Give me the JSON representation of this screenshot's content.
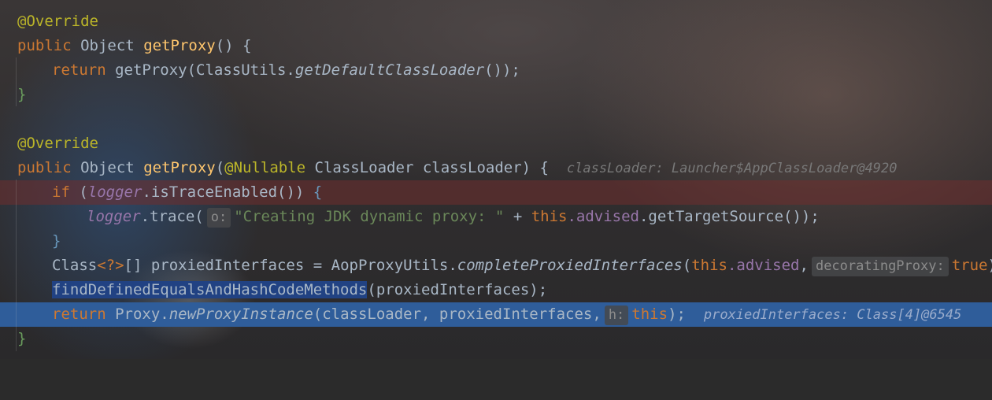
{
  "editor": {
    "lines": [
      {
        "id": "l1",
        "text": "@Override"
      },
      {
        "id": "l2",
        "kw": "public",
        "type": "Object",
        "name": "getProxy",
        "rest": "() {"
      },
      {
        "id": "l3",
        "kw": "return",
        "call": "getProxy(ClassUtils.",
        "method": "getDefaultClassLoader",
        "tail": "());"
      },
      {
        "id": "l4",
        "text": "}"
      },
      {
        "id": "l6",
        "text": "@Override"
      },
      {
        "id": "l7",
        "kw": "public",
        "type": "Object",
        "name": "getProxy",
        "open": "(",
        "annot": "@Nullable",
        "params": " ClassLoader classLoader",
        "close": ") {",
        "inline_value": "classLoader: Launcher$AppClassLoader@4920"
      },
      {
        "id": "l8",
        "kw": "if",
        "open": "(",
        "logger": "logger",
        "call": ".isTraceEnabled",
        "args": "())",
        "brace": " {"
      },
      {
        "id": "l9",
        "logger": "logger",
        "call": ".trace(",
        "hint": "o:",
        "string": "\"Creating JDK dynamic proxy: \"",
        "plus": " + ",
        "this": "this",
        "field": ".advised",
        "method": ".getTargetSource",
        "tail": "());"
      },
      {
        "id": "l10",
        "text": "}"
      },
      {
        "id": "l11",
        "type": "Class",
        "generic": "<?>",
        "rest": "[] proxiedInterfaces = AopProxyUtils.",
        "method": "completeProxiedInterfaces",
        "open": "(",
        "this": "this",
        "field": ".advised",
        "comma": ",",
        "hint": "decoratingProxy:",
        "value": "true",
        "tail": ");"
      },
      {
        "id": "l12",
        "selected": "findDefinedEqualsAndHashCodeMethods",
        "args": "(proxiedInterfaces);"
      },
      {
        "id": "l13",
        "kw": "return",
        "call": "Proxy.",
        "method": "newProxyInstance",
        "args": "(classLoader, proxiedInterfaces,",
        "hint": "h:",
        "this": "this",
        "tail": ");",
        "inline_value": "proxiedInterfaces: Class[4]@6545"
      },
      {
        "id": "l14",
        "text": "}"
      }
    ]
  },
  "colors": {
    "keyword": "#cc7832",
    "annotation": "#bbb529",
    "method_decl": "#ffc66d",
    "identifier": "#a9b7c6",
    "string": "#6a8759",
    "field": "#9876aa",
    "breakpoint_line": "#702d2d",
    "execution_line": "#2f5d9a",
    "selection": "#214283"
  }
}
